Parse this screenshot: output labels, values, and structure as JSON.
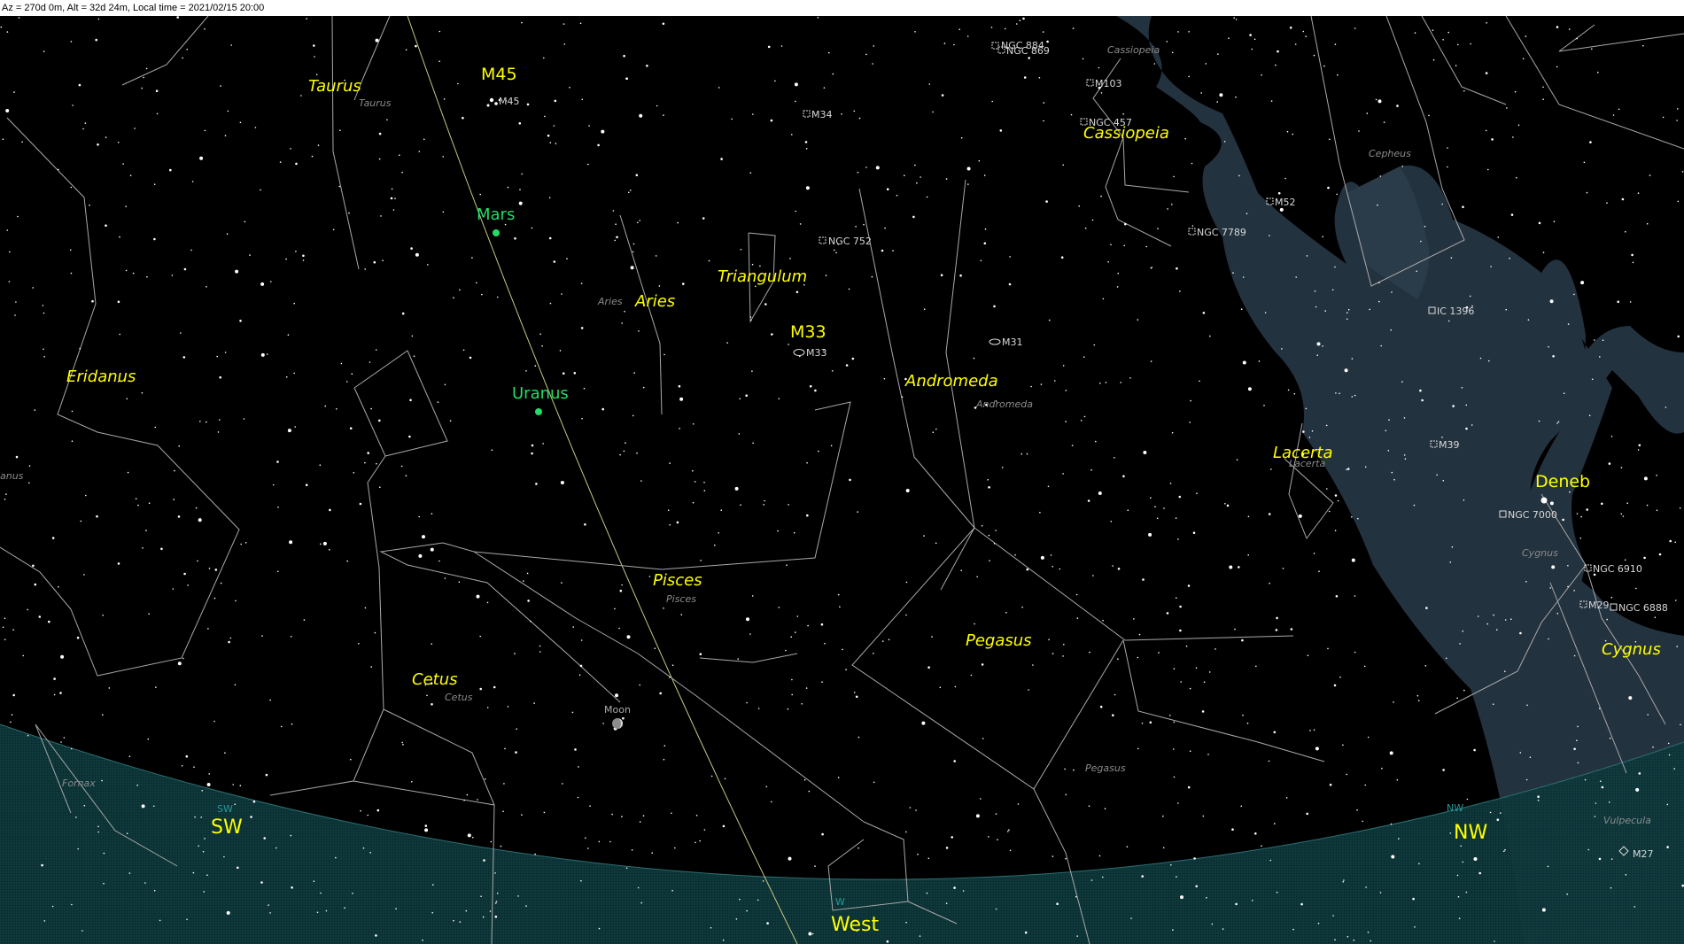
{
  "status_bar": {
    "text": "Az = 270d 0m, Alt = 32d 24m, Local time = 2021/02/15 20:00"
  },
  "colors": {
    "sky": "#000000",
    "milky_way": "#23323f",
    "horizon": "#0d3a3d",
    "ecliptic": "#c8c882",
    "constellation_name": "#ffff00",
    "planet": "#22dd66"
  },
  "constellations": [
    {
      "key": "taurus",
      "name": "Taurus",
      "small": "Taurus"
    },
    {
      "key": "aries",
      "name": "Aries",
      "small": "Aries"
    },
    {
      "key": "triangulum",
      "name": "Triangulum",
      "small": ""
    },
    {
      "key": "eridanus",
      "name": "Eridanus",
      "small": ""
    },
    {
      "key": "andromeda",
      "name": "Andromeda",
      "small": "Andromeda"
    },
    {
      "key": "pisces",
      "name": "Pisces",
      "small": "Pisces"
    },
    {
      "key": "cetus",
      "name": "Cetus",
      "small": "Cetus"
    },
    {
      "key": "pegasus",
      "name": "Pegasus",
      "small": "Pegasus"
    },
    {
      "key": "cassiopeia",
      "name": "Cassiopeia",
      "small": "Cassiopeia"
    },
    {
      "key": "lacerta",
      "name": "Lacerta",
      "small": "Lacerta"
    },
    {
      "key": "cygnus",
      "name": "Cygnus",
      "small": "Cygnus"
    }
  ],
  "constellation_extra_small": {
    "cepheus": "Cepheus",
    "fornax": "Fornax",
    "vulpecula": "Vulpecula",
    "eridanus_cut": "anus"
  },
  "big_objects": {
    "m45": "M45",
    "m33": "M33",
    "deneb": "Deneb"
  },
  "planets": {
    "mars": "Mars",
    "uranus": "Uranus",
    "moon": "Moon"
  },
  "deep_sky": {
    "m45": "M45",
    "m34": "M34",
    "ngc752": "NGC 752",
    "m33": "M33",
    "m31": "M31",
    "ngc884": "NGC 884",
    "ngc869": "NGC 869",
    "m103": "M103",
    "ngc457": "NGC 457",
    "m52": "M52",
    "ngc7789": "NGC 7789",
    "ic1396": "IC 1396",
    "m39": "M39",
    "ngc7000": "NGC 7000",
    "ngc6910": "NGC 6910",
    "m29": "M29",
    "ngc6888": "NGC 6888",
    "m27": "M27"
  },
  "directions": {
    "sw": "SW",
    "west": "West",
    "nw": "NW",
    "sw_small": "SW",
    "w_small": "W",
    "nw_small": "NW"
  }
}
